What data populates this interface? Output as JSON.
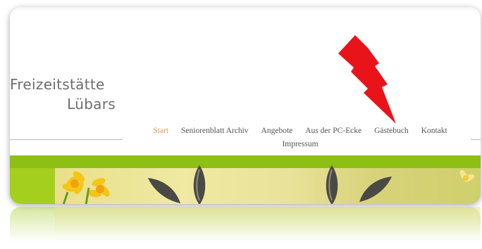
{
  "site": {
    "title_line1": "Freizeitstätte",
    "title_line2": "Lübars"
  },
  "nav": {
    "items": [
      {
        "label": "Start",
        "active": true
      },
      {
        "label": "Seniorenblatt Archiv"
      },
      {
        "label": "Angebote"
      },
      {
        "label": "Aus der PC-Ecke"
      },
      {
        "label": "Gästebuch"
      },
      {
        "label": "Kontakt"
      },
      {
        "label": "Impressum"
      }
    ]
  },
  "colors": {
    "accent_nav_active": "#e29b52",
    "nav_text": "#555555",
    "title_text": "#6d6d6d",
    "green_band": "#8dbf15",
    "arrow": "#e8141a"
  },
  "annotation": {
    "icon": "red-lightning-arrow-icon"
  },
  "banner": {
    "icon": "spring-flowers-image"
  }
}
